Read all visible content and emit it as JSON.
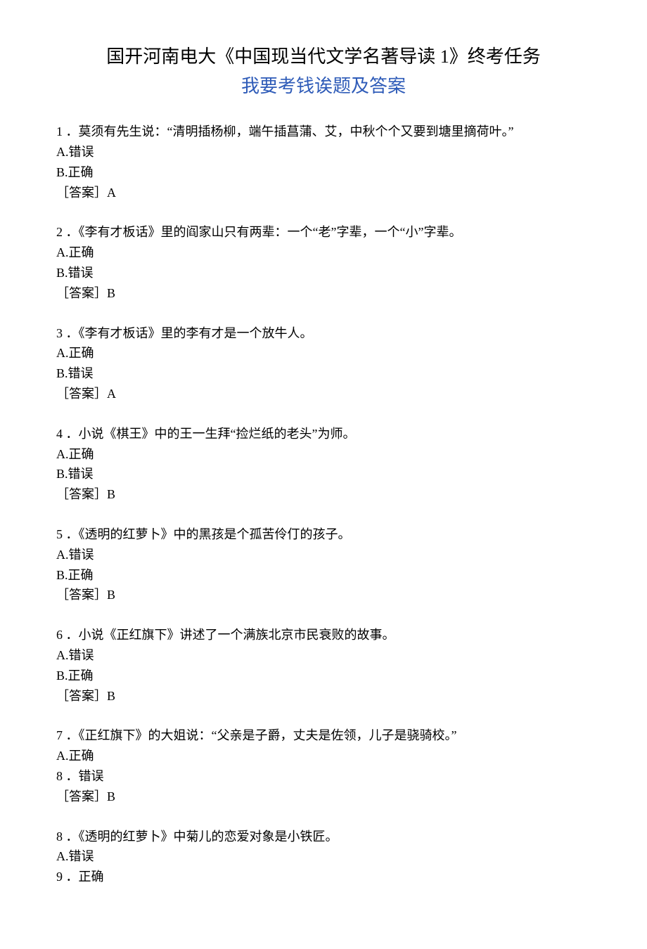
{
  "title": {
    "line1": "国开河南电大《中国现当代文学名著导读 1》终考任务",
    "line2": "我要考钱诶题及答案"
  },
  "questions": [
    {
      "num": "1",
      "text": "．莫须有先生说：“清明插杨柳，端午插菖蒲、艾，中秋个个又要到塘里摘荷叶。”",
      "optA": "A.错误",
      "optB": "B.正确",
      "answer": "［答案］A"
    },
    {
      "num": "2",
      "text": "．《李有才板话》里的阎家山只有两辈：一个“老”字辈，一个“小”字辈。",
      "optA": "A.正确",
      "optB": "B.错误",
      "answer": "［答案］B"
    },
    {
      "num": "3",
      "text": "．《李有才板话》里的李有才是一个放牛人。",
      "optA": "A.正确",
      "optB": "B.错误",
      "answer": "［答案］A"
    },
    {
      "num": "4",
      "text": "．小说《棋王》中的王一生拜“捡烂纸的老头”为师。",
      "optA": "A.正确",
      "optB": "B.错误",
      "answer": "［答案］B"
    },
    {
      "num": "5",
      "text": "．《透明的红萝卜》中的黑孩是个孤苦伶仃的孩子。",
      "optA": "A.错误",
      "optB": "B.正确",
      "answer": "［答案］B"
    },
    {
      "num": "6",
      "text": "．小说《正红旗下》讲述了一个满族北京市民衰败的故事。",
      "optA": "A.错误",
      "optB": "B.正确",
      "answer": "［答案］B"
    },
    {
      "num": "7",
      "text": "．《正红旗下》的大姐说：“父亲是子爵，丈夫是佐领，儿子是骁骑校。”",
      "optA": "A.正确",
      "optBNum": "8",
      "optB": "．错误",
      "answer": "［答案］B"
    },
    {
      "num": "8",
      "text": "．《透明的红萝卜》中菊儿的恋爱对象是小铁匠。",
      "optA": "A.错误",
      "optBNum": "9",
      "optB": "．正确",
      "answer": ""
    }
  ]
}
